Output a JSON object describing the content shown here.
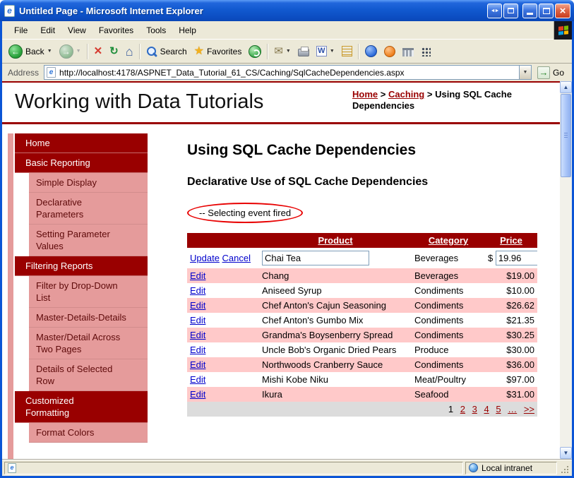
{
  "window": {
    "title": "Untitled Page - Microsoft Internet Explorer"
  },
  "menu": {
    "items": [
      "File",
      "Edit",
      "View",
      "Favorites",
      "Tools",
      "Help"
    ]
  },
  "toolbar": {
    "back": "Back",
    "search": "Search",
    "favorites": "Favorites"
  },
  "address": {
    "label": "Address",
    "url": "http://localhost:4178/ASPNET_Data_Tutorial_61_CS/Caching/SqlCacheDependencies.aspx",
    "go": "Go"
  },
  "statusbar": {
    "zone": "Local intranet"
  },
  "header": {
    "site_title": "Working with Data Tutorials",
    "breadcrumb": {
      "home": "Home",
      "separator": ">",
      "section": "Caching",
      "current": "Using SQL Cache Dependencies"
    }
  },
  "sidebar": {
    "items": [
      {
        "label": "Home",
        "type": "header"
      },
      {
        "label": "Basic Reporting",
        "type": "header"
      },
      {
        "label": "Simple Display",
        "type": "sub"
      },
      {
        "label": "Declarative Parameters",
        "type": "sub"
      },
      {
        "label": "Setting Parameter Values",
        "type": "sub"
      },
      {
        "label": "Filtering Reports",
        "type": "header"
      },
      {
        "label": "Filter by Drop-Down List",
        "type": "sub"
      },
      {
        "label": "Master-Details-Details",
        "type": "sub"
      },
      {
        "label": "Master/Detail Across Two Pages",
        "type": "sub"
      },
      {
        "label": "Details of Selected Row",
        "type": "sub"
      },
      {
        "label": "Customized Formatting",
        "type": "header"
      },
      {
        "label": "Format Colors",
        "type": "sub"
      }
    ]
  },
  "main": {
    "title": "Using SQL Cache Dependencies",
    "subtitle": "Declarative Use of SQL Cache Dependencies",
    "event_message": "-- Selecting event fired",
    "grid": {
      "headers": [
        "",
        "Product",
        "Category",
        "Price"
      ],
      "edit_row": {
        "update": "Update",
        "cancel": "Cancel",
        "product": "Chai Tea",
        "category": "Beverages",
        "currency": "$",
        "price": "19.96"
      },
      "rows": [
        {
          "action": "Edit",
          "product": "Chang",
          "category": "Beverages",
          "price": "$19.00"
        },
        {
          "action": "Edit",
          "product": "Aniseed Syrup",
          "category": "Condiments",
          "price": "$10.00"
        },
        {
          "action": "Edit",
          "product": "Chef Anton's Cajun Seasoning",
          "category": "Condiments",
          "price": "$26.62"
        },
        {
          "action": "Edit",
          "product": "Chef Anton's Gumbo Mix",
          "category": "Condiments",
          "price": "$21.35"
        },
        {
          "action": "Edit",
          "product": "Grandma's Boysenberry Spread",
          "category": "Condiments",
          "price": "$30.25"
        },
        {
          "action": "Edit",
          "product": "Uncle Bob's Organic Dried Pears",
          "category": "Produce",
          "price": "$30.00"
        },
        {
          "action": "Edit",
          "product": "Northwoods Cranberry Sauce",
          "category": "Condiments",
          "price": "$36.00"
        },
        {
          "action": "Edit",
          "product": "Mishi Kobe Niku",
          "category": "Meat/Poultry",
          "price": "$97.00"
        },
        {
          "action": "Edit",
          "product": "Ikura",
          "category": "Seafood",
          "price": "$31.00"
        }
      ],
      "pager": {
        "current": "1",
        "links": [
          "2",
          "3",
          "4",
          "5",
          "…",
          ">>"
        ]
      }
    }
  },
  "colors": {
    "maroon": "#990000",
    "row-pink": "#FFC9C9",
    "sidebar-pink": "#E59B9B",
    "link-blue": "#0000CC",
    "pager-gray": "#DCDCDC",
    "annotation-red": "#E80000",
    "titlebar-blue": "#0B55D6"
  }
}
